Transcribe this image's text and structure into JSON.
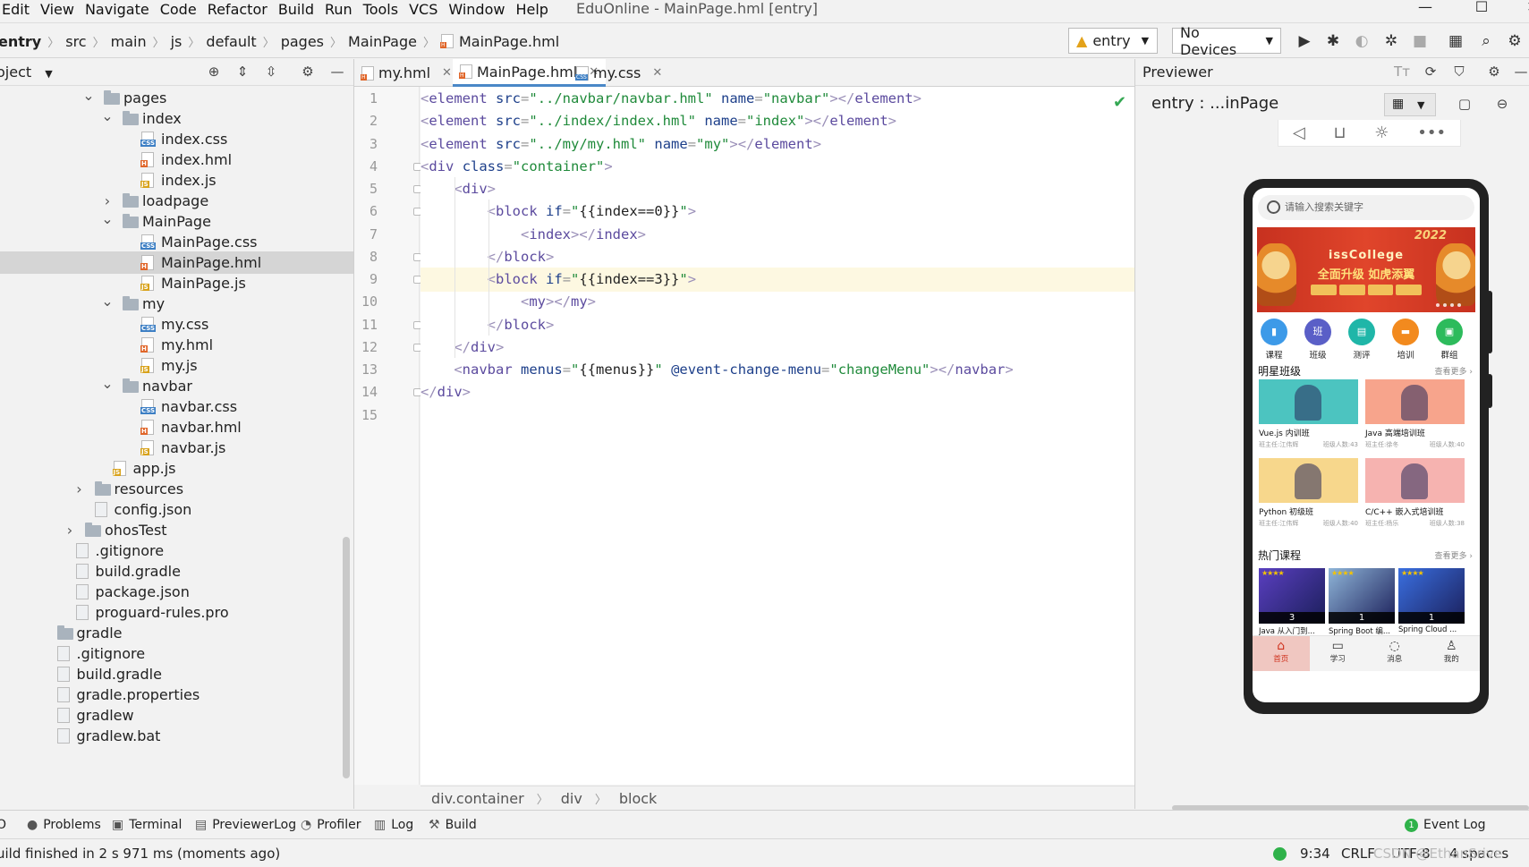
{
  "menu": [
    "Edit",
    "View",
    "Navigate",
    "Code",
    "Refactor",
    "Build",
    "Run",
    "Tools",
    "VCS",
    "Window",
    "Help"
  ],
  "window_title": "EduOnline - MainPage.hml [entry]",
  "breadcrumbs": [
    "entry",
    "src",
    "main",
    "js",
    "default",
    "pages",
    "MainPage",
    "MainPage.hml"
  ],
  "run_config": "entry",
  "device_selector": "No Devices",
  "project_panel": {
    "title": "oject"
  },
  "tree": [
    {
      "label": "pages",
      "depth": 1,
      "kind": "folder",
      "expanded": true
    },
    {
      "label": "index",
      "depth": 2,
      "kind": "folder",
      "expanded": true
    },
    {
      "label": "index.css",
      "depth": 3,
      "kind": "css"
    },
    {
      "label": "index.hml",
      "depth": 3,
      "kind": "hml"
    },
    {
      "label": "index.js",
      "depth": 3,
      "kind": "js"
    },
    {
      "label": "loadpage",
      "depth": 2,
      "kind": "folder",
      "expanded": false
    },
    {
      "label": "MainPage",
      "depth": 2,
      "kind": "folder",
      "expanded": true
    },
    {
      "label": "MainPage.css",
      "depth": 3,
      "kind": "css"
    },
    {
      "label": "MainPage.hml",
      "depth": 3,
      "kind": "hml",
      "selected": true
    },
    {
      "label": "MainPage.js",
      "depth": 3,
      "kind": "js"
    },
    {
      "label": "my",
      "depth": 2,
      "kind": "folder",
      "expanded": true
    },
    {
      "label": "my.css",
      "depth": 3,
      "kind": "css"
    },
    {
      "label": "my.hml",
      "depth": 3,
      "kind": "hml"
    },
    {
      "label": "my.js",
      "depth": 3,
      "kind": "js"
    },
    {
      "label": "navbar",
      "depth": 2,
      "kind": "folder",
      "expanded": true
    },
    {
      "label": "navbar.css",
      "depth": 3,
      "kind": "css"
    },
    {
      "label": "navbar.hml",
      "depth": 3,
      "kind": "hml"
    },
    {
      "label": "navbar.js",
      "depth": 3,
      "kind": "js"
    },
    {
      "label": "app.js",
      "depth": 1.5,
      "kind": "js"
    },
    {
      "label": "resources",
      "depth": 0.5,
      "kind": "folder",
      "expanded": false
    },
    {
      "label": "config.json",
      "depth": 0.5,
      "kind": "json"
    },
    {
      "label": "ohosTest",
      "depth": 0,
      "kind": "folder",
      "expanded": false
    },
    {
      "label": ".gitignore",
      "depth": -0.5,
      "kind": "gen"
    },
    {
      "label": "build.gradle",
      "depth": -0.5,
      "kind": "gen"
    },
    {
      "label": "package.json",
      "depth": -0.5,
      "kind": "gen"
    },
    {
      "label": "proguard-rules.pro",
      "depth": -0.5,
      "kind": "gen"
    },
    {
      "label": "gradle",
      "depth": -1.5,
      "kind": "folder"
    },
    {
      "label": ".gitignore",
      "depth": -1.5,
      "kind": "gen"
    },
    {
      "label": "build.gradle",
      "depth": -1.5,
      "kind": "gen"
    },
    {
      "label": "gradle.properties",
      "depth": -1.5,
      "kind": "gen"
    },
    {
      "label": "gradlew",
      "depth": -1.5,
      "kind": "gen"
    },
    {
      "label": "gradlew.bat",
      "depth": -1.5,
      "kind": "gen"
    }
  ],
  "editor_tabs": [
    {
      "label": "my.hml",
      "kind": "hml",
      "active": false
    },
    {
      "label": "MainPage.hml",
      "kind": "hml",
      "active": true
    },
    {
      "label": "my.css",
      "kind": "css",
      "active": false
    }
  ],
  "code_lines": [
    [
      [
        "tg",
        "<"
      ],
      [
        "tn",
        "element"
      ],
      [
        "plain",
        " "
      ],
      [
        "at",
        "src"
      ],
      [
        "eq",
        "="
      ],
      [
        "st",
        "\"../navbar/navbar.hml\""
      ],
      [
        "plain",
        " "
      ],
      [
        "at",
        "name"
      ],
      [
        "eq",
        "="
      ],
      [
        "st",
        "\"navbar\""
      ],
      [
        "tg",
        "></"
      ],
      [
        "tn",
        "element"
      ],
      [
        "tg",
        ">"
      ]
    ],
    [
      [
        "tg",
        "<"
      ],
      [
        "tn",
        "element"
      ],
      [
        "plain",
        " "
      ],
      [
        "at",
        "src"
      ],
      [
        "eq",
        "="
      ],
      [
        "st",
        "\"../index/index.hml\""
      ],
      [
        "plain",
        " "
      ],
      [
        "at",
        "name"
      ],
      [
        "eq",
        "="
      ],
      [
        "st",
        "\"index\""
      ],
      [
        "tg",
        "></"
      ],
      [
        "tn",
        "element"
      ],
      [
        "tg",
        ">"
      ]
    ],
    [
      [
        "tg",
        "<"
      ],
      [
        "tn",
        "element"
      ],
      [
        "plain",
        " "
      ],
      [
        "at",
        "src"
      ],
      [
        "eq",
        "="
      ],
      [
        "st",
        "\"../my/my.hml\""
      ],
      [
        "plain",
        " "
      ],
      [
        "at",
        "name"
      ],
      [
        "eq",
        "="
      ],
      [
        "st",
        "\"my\""
      ],
      [
        "tg",
        "></"
      ],
      [
        "tn",
        "element"
      ],
      [
        "tg",
        ">"
      ]
    ],
    [
      [
        "tg",
        "<"
      ],
      [
        "tn",
        "div"
      ],
      [
        "plain",
        " "
      ],
      [
        "at",
        "class"
      ],
      [
        "eq",
        "="
      ],
      [
        "st",
        "\"container\""
      ],
      [
        "tg",
        ">"
      ]
    ],
    [
      [
        "plain",
        "    "
      ],
      [
        "tg",
        "<"
      ],
      [
        "tn",
        "div"
      ],
      [
        "tg",
        ">"
      ]
    ],
    [
      [
        "plain",
        "        "
      ],
      [
        "tg",
        "<"
      ],
      [
        "tn",
        "block"
      ],
      [
        "plain",
        " "
      ],
      [
        "at",
        "if"
      ],
      [
        "eq",
        "="
      ],
      [
        "st",
        "\""
      ],
      [
        "plain",
        "{{index==0}}"
      ],
      [
        "st",
        "\""
      ],
      [
        "tg",
        ">"
      ]
    ],
    [
      [
        "plain",
        "            "
      ],
      [
        "tg",
        "<"
      ],
      [
        "tn",
        "index"
      ],
      [
        "tg",
        "></"
      ],
      [
        "tn",
        "index"
      ],
      [
        "tg",
        ">"
      ]
    ],
    [
      [
        "plain",
        "        "
      ],
      [
        "tg",
        "</"
      ],
      [
        "tn",
        "block"
      ],
      [
        "tg",
        ">"
      ]
    ],
    [
      [
        "plain",
        "        "
      ],
      [
        "tg",
        "<"
      ],
      [
        "tn",
        "block"
      ],
      [
        "plain",
        " "
      ],
      [
        "at",
        "if"
      ],
      [
        "eq",
        "="
      ],
      [
        "st",
        "\""
      ],
      [
        "plain",
        "{{index==3}}"
      ],
      [
        "st",
        "\""
      ],
      [
        "tg",
        ">"
      ]
    ],
    [
      [
        "plain",
        "            "
      ],
      [
        "tg",
        "<"
      ],
      [
        "tn",
        "my"
      ],
      [
        "tg",
        "></"
      ],
      [
        "tn",
        "my"
      ],
      [
        "tg",
        ">"
      ]
    ],
    [
      [
        "plain",
        "        "
      ],
      [
        "tg",
        "</"
      ],
      [
        "tn",
        "block"
      ],
      [
        "tg",
        ">"
      ]
    ],
    [
      [
        "plain",
        "    "
      ],
      [
        "tg",
        "</"
      ],
      [
        "tn",
        "div"
      ],
      [
        "tg",
        ">"
      ]
    ],
    [
      [
        "plain",
        "    "
      ],
      [
        "tg",
        "<"
      ],
      [
        "tn",
        "navbar"
      ],
      [
        "plain",
        " "
      ],
      [
        "at",
        "menus"
      ],
      [
        "eq",
        "="
      ],
      [
        "st",
        "\""
      ],
      [
        "plain",
        "{{menus}}"
      ],
      [
        "st",
        "\""
      ],
      [
        "plain",
        " "
      ],
      [
        "at",
        "@event-change-menu"
      ],
      [
        "eq",
        "="
      ],
      [
        "st",
        "\"changeMenu\""
      ],
      [
        "tg",
        "></"
      ],
      [
        "tn",
        "navbar"
      ],
      [
        "tg",
        ">"
      ]
    ],
    [
      [
        "tg",
        "</"
      ],
      [
        "tn",
        "div"
      ],
      [
        "tg",
        ">"
      ]
    ],
    []
  ],
  "highlighted_line": 9,
  "editor_breadcrumbs": [
    "div.container",
    "div",
    "block"
  ],
  "previewer": {
    "title": "Previewer",
    "subtitle": "entry : ...inPage",
    "phone": {
      "search_placeholder": "请输入搜索关键字",
      "banner_brand": "issCollege",
      "banner_slogan": "全面升级 如虎添翼",
      "banner_year": "2022",
      "categories": [
        {
          "label": "课程",
          "icon": "▮",
          "color": "#3d9ae8"
        },
        {
          "label": "班级",
          "icon": "班",
          "color": "#5a5fc7"
        },
        {
          "label": "测评",
          "icon": "▤",
          "color": "#1fb6a8"
        },
        {
          "label": "培训",
          "icon": "▬",
          "color": "#f28a1e"
        },
        {
          "label": "群组",
          "icon": "▣",
          "color": "#2dbb5c"
        }
      ],
      "section1_title": "明星班级",
      "section1_more": "查看更多",
      "classes": [
        {
          "name": "Vue.js 内训班",
          "teacher": "班主任:江伟辉",
          "count": "班级人数:43",
          "bg": "#4cc4c0"
        },
        {
          "name": "Java 高端培训班",
          "teacher": "班主任:徐冬",
          "count": "班级人数:40",
          "bg": "#f7a48c"
        },
        {
          "name": "Python 初级班",
          "teacher": "班主任:江伟辉",
          "count": "班级人数:40",
          "bg": "#f7d78c"
        },
        {
          "name": "C/C++ 嵌入式培训班",
          "teacher": "班主任:杨乐",
          "count": "班级人数:38",
          "bg": "#f6b3b0"
        }
      ],
      "section2_title": "热门课程",
      "section2_more": "查看更多",
      "courses": [
        {
          "name": "Java 从入门到...",
          "count": "3",
          "bg": "#5a3fc0"
        },
        {
          "name": "Spring Boot 编...",
          "count": "1",
          "bg": "#8fb5d8"
        },
        {
          "name": "Spring Cloud ...",
          "count": "1",
          "bg": "#3a6fe0"
        }
      ],
      "tabs": [
        {
          "label": "首页",
          "icon": "⌂",
          "active": true
        },
        {
          "label": "学习",
          "icon": "▭",
          "active": false
        },
        {
          "label": "消息",
          "icon": "◌",
          "active": false
        },
        {
          "label": "我的",
          "icon": "♙",
          "active": false
        }
      ]
    }
  },
  "toolwindows": [
    {
      "label": "O",
      "icon": ""
    },
    {
      "label": "Problems",
      "icon": "●"
    },
    {
      "label": "Terminal",
      "icon": "▣"
    },
    {
      "label": "PreviewerLog",
      "icon": "▤"
    },
    {
      "label": "Profiler",
      "icon": "◔"
    },
    {
      "label": "Log",
      "icon": "▥"
    },
    {
      "label": "Build",
      "icon": "⚒"
    }
  ],
  "event_log": "Event Log",
  "status": {
    "message": "uild finished in 2 s 971 ms (moments ago)",
    "position": "9:34",
    "line_sep": "CRLF",
    "encoding": "UTF-8",
    "indent": "4 spaces",
    "watermark": "CSDN @EthanSrive"
  }
}
